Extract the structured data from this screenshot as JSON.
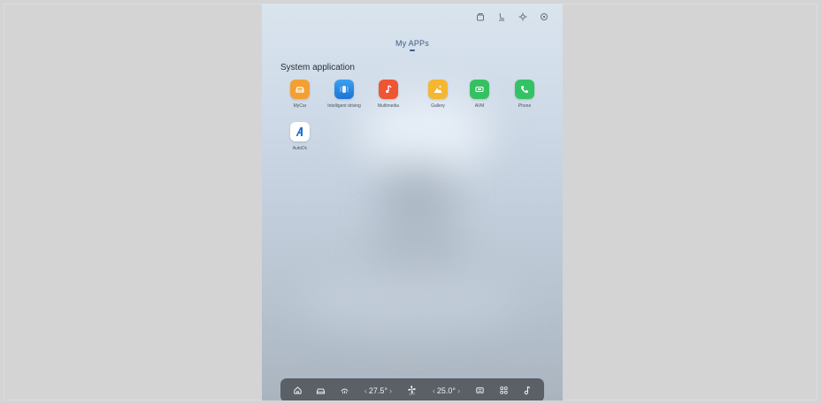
{
  "page": {
    "title": "My APPs",
    "section": "System application"
  },
  "status_icons": [
    "profile-icon",
    "seat-icon",
    "settings-icon",
    "connection-icon"
  ],
  "apps": [
    {
      "label": "MyCar",
      "icon": "car-icon",
      "color": "#f2a033"
    },
    {
      "label": "Intelligent driving",
      "icon": "driving-icon",
      "color": "#2f8ce6"
    },
    {
      "label": "Multimedia",
      "icon": "music-note-icon",
      "color": "#ee5533"
    },
    {
      "label": "Gallery",
      "icon": "image-icon",
      "color": "#f5b631"
    },
    {
      "label": "AVM",
      "icon": "camera-view-icon",
      "color": "#37c062"
    },
    {
      "label": "Phone",
      "icon": "phone-icon",
      "color": "#34c267"
    },
    {
      "label": "AutoDc",
      "icon": "autodc-logo-icon",
      "color": "#ffffff"
    }
  ],
  "dock": {
    "left_temp": "27.5°",
    "right_temp": "25.0°",
    "fan_state": "OFF",
    "prev": "‹",
    "next": "›"
  }
}
